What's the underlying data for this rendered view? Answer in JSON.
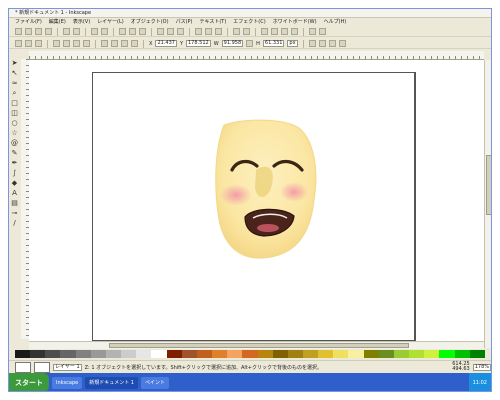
{
  "window": {
    "title": "* 新規ドキュメント 1 - Inkscape"
  },
  "menu": [
    "ファイル(F)",
    "編集(E)",
    "表示(V)",
    "レイヤー(L)",
    "オブジェクト(O)",
    "パス(P)",
    "テキスト(T)",
    "エフェクト(C)",
    "ホワイトボード(W)",
    "ヘルプ(H)"
  ],
  "toolbar2": {
    "x_label": "X",
    "x_value": "21.437",
    "y_label": "Y",
    "y_value": "178.512",
    "w_label": "W",
    "w_value": "91.958",
    "h_label": "H",
    "h_value": "61.331",
    "unit": "px"
  },
  "status": {
    "layer": "レイヤー 1",
    "message": "Z: 1 オブジェクトを選択しています。Shift+クリックで選択に追加、Alt+クリックで背後のものを選択。",
    "coords_x": "614.25",
    "coords_y": "494.63",
    "zoom": "178%"
  },
  "taskbar": {
    "start": "スタート",
    "tasks": [
      "Inkscape",
      "新規ドキュメント 1",
      "ペイント"
    ],
    "clock": "11:02"
  },
  "colors": {
    "face": "#fbe7a4",
    "accent": "#2f5fcb"
  },
  "palette": [
    "#1a1a1a",
    "#333333",
    "#4d4d4d",
    "#666666",
    "#808080",
    "#999999",
    "#b3b3b3",
    "#cccccc",
    "#e6e6e6",
    "#ffffff",
    "#7f1f00",
    "#a0522d",
    "#c06020",
    "#e0802b",
    "#f4a460",
    "#d2691e",
    "#b8860b",
    "#806000",
    "#a08010",
    "#c0a020",
    "#e0c030",
    "#f0e060",
    "#f8f0a0",
    "#808000",
    "#6b8e23",
    "#9acd32",
    "#b0e030",
    "#d0f040",
    "#00ff00",
    "#00c000",
    "#008000"
  ]
}
